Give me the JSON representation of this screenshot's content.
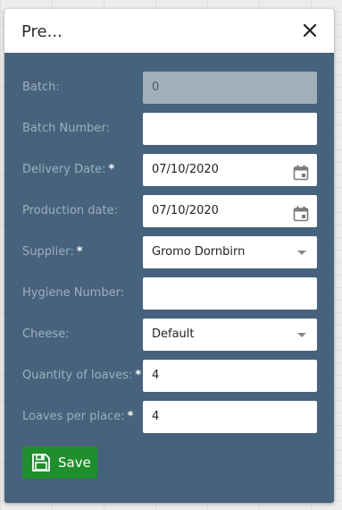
{
  "dialog": {
    "title": "Pre...",
    "close_icon": "close-icon"
  },
  "form": {
    "batch": {
      "label": "Batch:",
      "value": "0",
      "required": false,
      "disabled": true
    },
    "batch_number": {
      "label": "Batch Number:",
      "value": ""
    },
    "delivery_date": {
      "label": "Delivery Date:",
      "required_mark": "*",
      "value": "07/10/2020",
      "icon": "calendar-icon"
    },
    "production_date": {
      "label": "Production date:",
      "value": "07/10/2020",
      "icon": "calendar-icon"
    },
    "supplier": {
      "label": "Supplier:",
      "required_mark": "*",
      "value": "Gromo Dornbirn"
    },
    "hygiene_number": {
      "label": "Hygiene Number:",
      "value": ""
    },
    "cheese": {
      "label": "Cheese:",
      "value": "Default"
    },
    "quantity_of_loaves": {
      "label": "Quantity of loaves:",
      "required_mark": "*",
      "value": "4"
    },
    "loaves_per_place": {
      "label": "Loaves per place:",
      "required_mark": "*",
      "value": "4"
    }
  },
  "save_button": {
    "label": "Save",
    "icon": "floppy-disk-icon"
  },
  "colors": {
    "dialog_bg": "#46627c",
    "label": "#9fb0bf",
    "save_green": "#1e8f2c",
    "disabled_field": "#a2afb9"
  }
}
